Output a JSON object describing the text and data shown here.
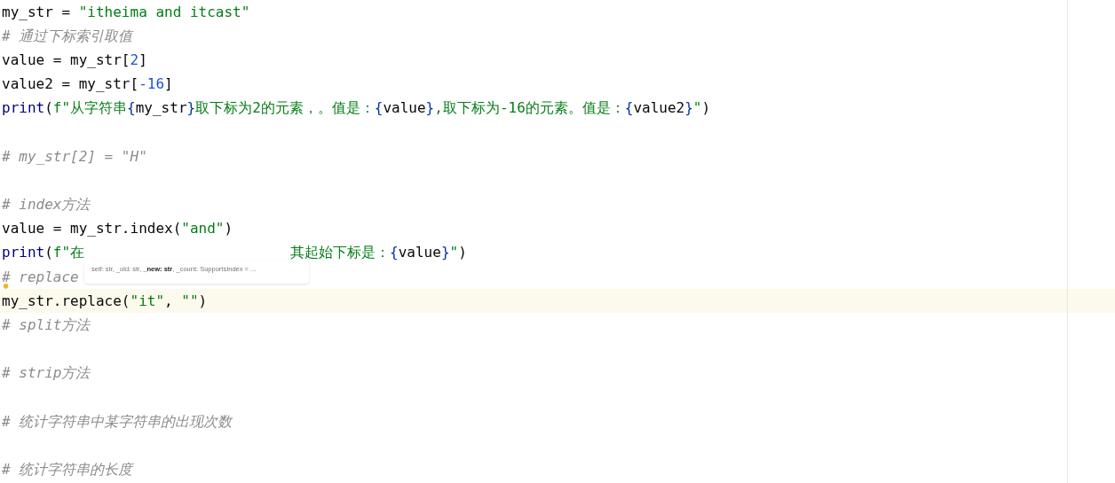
{
  "editor": {
    "lines": [
      {
        "highlighted": false,
        "tokens": [
          {
            "kind": "plain",
            "text": "my_str = "
          },
          {
            "kind": "string",
            "text": "\"itheima and itcast\""
          }
        ]
      },
      {
        "highlighted": false,
        "tokens": [
          {
            "kind": "comment",
            "text": "# 通过下标索引取值"
          }
        ]
      },
      {
        "highlighted": false,
        "tokens": [
          {
            "kind": "plain",
            "text": "value = my_str["
          },
          {
            "kind": "number",
            "text": "2"
          },
          {
            "kind": "plain",
            "text": "]"
          }
        ]
      },
      {
        "highlighted": false,
        "tokens": [
          {
            "kind": "plain",
            "text": "value2 = my_str["
          },
          {
            "kind": "number",
            "text": "-16"
          },
          {
            "kind": "plain",
            "text": "]"
          }
        ]
      },
      {
        "highlighted": false,
        "tokens": [
          {
            "kind": "builtin",
            "text": "print"
          },
          {
            "kind": "plain",
            "text": "("
          },
          {
            "kind": "string",
            "text": "f\"从字符串"
          },
          {
            "kind": "brace",
            "text": "{"
          },
          {
            "kind": "plain",
            "text": "my_str"
          },
          {
            "kind": "brace",
            "text": "}"
          },
          {
            "kind": "string",
            "text": "取下标为2的元素，。值是："
          },
          {
            "kind": "brace",
            "text": "{"
          },
          {
            "kind": "plain",
            "text": "value"
          },
          {
            "kind": "brace",
            "text": "}"
          },
          {
            "kind": "string",
            "text": ",取下标为-16的元素。值是："
          },
          {
            "kind": "brace",
            "text": "{"
          },
          {
            "kind": "plain",
            "text": "value2"
          },
          {
            "kind": "brace",
            "text": "}"
          },
          {
            "kind": "string",
            "text": "\""
          },
          {
            "kind": "plain",
            "text": ")"
          }
        ]
      },
      {
        "highlighted": false
      },
      {
        "highlighted": false,
        "tokens": [
          {
            "kind": "comment",
            "text": "# my_str[2] = \"H\""
          }
        ]
      },
      {
        "highlighted": false
      },
      {
        "highlighted": false,
        "tokens": [
          {
            "kind": "comment",
            "text": "# index方法"
          }
        ]
      },
      {
        "highlighted": false,
        "tokens": [
          {
            "kind": "plain",
            "text": "value = my_str.index("
          },
          {
            "kind": "string",
            "text": "\"and\""
          },
          {
            "kind": "plain",
            "text": ")"
          }
        ]
      },
      {
        "highlighted": false,
        "tokens": [
          {
            "kind": "builtin",
            "text": "print"
          },
          {
            "kind": "plain",
            "text": "("
          },
          {
            "kind": "string",
            "text": "f\"在"
          },
          {
            "kind": "covered"
          },
          {
            "kind": "string",
            "text": "其起始下标是："
          },
          {
            "kind": "brace",
            "text": "{"
          },
          {
            "kind": "plain",
            "text": "value"
          },
          {
            "kind": "brace",
            "text": "}"
          },
          {
            "kind": "string",
            "text": "\""
          },
          {
            "kind": "plain",
            "text": ")"
          }
        ]
      },
      {
        "highlighted": false,
        "tokens": [
          {
            "kind": "comment",
            "text": "# replace"
          }
        ]
      },
      {
        "highlighted": true,
        "tokens": [
          {
            "kind": "plain",
            "text": "my_str.replace("
          },
          {
            "kind": "string",
            "text": "\"it\""
          },
          {
            "kind": "plain",
            "text": ", "
          },
          {
            "kind": "string",
            "text": "\"\""
          },
          {
            "kind": "plain",
            "text": ")"
          }
        ]
      },
      {
        "highlighted": false,
        "tokens": [
          {
            "kind": "comment",
            "text": "# split方法"
          }
        ]
      },
      {
        "highlighted": false
      },
      {
        "highlighted": false,
        "tokens": [
          {
            "kind": "comment",
            "text": "# strip方法"
          }
        ]
      },
      {
        "highlighted": false
      },
      {
        "highlighted": false,
        "tokens": [
          {
            "kind": "comment",
            "text": "# 统计字符串中某字符串的出现次数"
          }
        ]
      },
      {
        "highlighted": false
      },
      {
        "highlighted": false,
        "tokens": [
          {
            "kind": "comment",
            "text": "# 统计字符串的长度"
          }
        ]
      }
    ],
    "parameter_hint": "self: str, _old: str, **_new: str**, _count: SupportsIndex = ..."
  }
}
